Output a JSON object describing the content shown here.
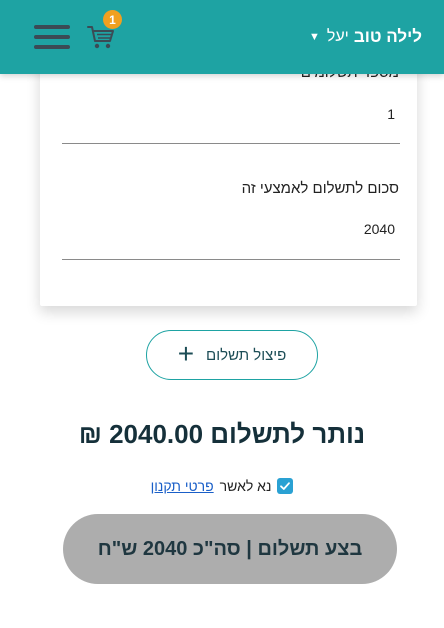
{
  "header": {
    "greeting_main": "לילה טוב",
    "greeting_name": "יעל",
    "cart_count": "1",
    "chevron_icon": "chevron-down-icon",
    "menu_icon": "hamburger-icon",
    "cart_icon": "cart-icon",
    "bg_color": "#1ea3a3",
    "badge_color": "#f0a020"
  },
  "card": {
    "installments_label": "מספר תשלומים",
    "installments_value": "1",
    "amount_label": "סכום לתשלום לאמצעי זה",
    "amount_value": "2040"
  },
  "split_button": {
    "label": "פיצול תשלום",
    "icon": "plus-icon"
  },
  "remaining": {
    "text": "נותר לתשלום 2040.00 ₪"
  },
  "terms": {
    "checked": true,
    "prefix": "נא לאשר",
    "link": "פרטי תקנון",
    "check_color": "#2aa1d3"
  },
  "pay_button": {
    "label": "בצע תשלום | סה\"כ 2040 ש\"ח",
    "color": "#adadad"
  }
}
